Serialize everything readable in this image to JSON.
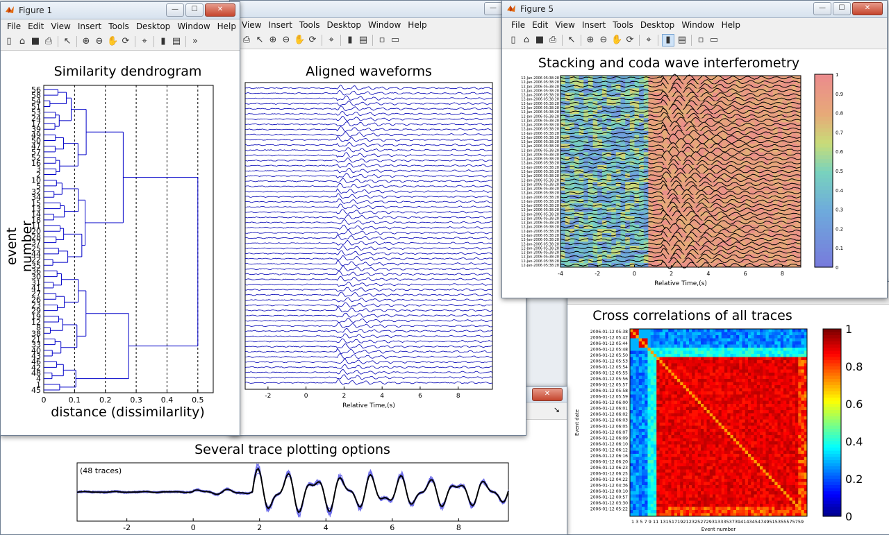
{
  "menu": [
    "File",
    "Edit",
    "View",
    "Insert",
    "Tools",
    "Desktop",
    "Window",
    "Help"
  ],
  "menu_partial": [
    "View",
    "Insert",
    "Tools",
    "Desktop",
    "Window",
    "Help"
  ],
  "fig1": {
    "title": "Figure 1",
    "plot_title": "Similarity dendrogram",
    "ylabel": "event number",
    "xlabel": "distance (dissimilarlity)",
    "xticks": [
      "0",
      "0.1",
      "0.2",
      "0.3",
      "0.4",
      "0.5"
    ],
    "leaf_labels": [
      "56",
      "58",
      "54",
      "51",
      "53",
      "24",
      "17",
      "39",
      "49",
      "50",
      "47",
      "57",
      "52",
      "16",
      "3",
      "2",
      "10",
      "5",
      "32",
      "34",
      "15",
      "13",
      "14",
      "18",
      "11",
      "20",
      "28",
      "37",
      "25",
      "44",
      "22",
      "35",
      "36",
      "30",
      "31",
      "41",
      "27",
      "26",
      "23",
      "29",
      "19",
      "12",
      "8",
      "38",
      "21",
      "33",
      "40",
      "43",
      "46",
      "42",
      "48",
      "4",
      "1",
      "45"
    ]
  },
  "fig2": {
    "plot_title": "Aligned waveforms",
    "xlabel": "Relative Time,(s)",
    "xticks": [
      "-2",
      "0",
      "2",
      "4",
      "6",
      "8"
    ]
  },
  "fig5": {
    "title": "Figure 5",
    "plot_title": "Stacking and coda wave interferometry",
    "xlabel": "Relative Time,(s)",
    "xticks": [
      "-4",
      "-2",
      "0",
      "2",
      "4",
      "6",
      "8"
    ],
    "cbar_ticks": [
      "0",
      "0.1",
      "0.2",
      "0.3",
      "0.4",
      "0.5",
      "0.6",
      "0.7",
      "0.8",
      "0.9",
      "1"
    ],
    "row_label": "12-Jan-2006 05:38:28"
  },
  "xcorr": {
    "plot_title": "Cross correlations of all traces",
    "ylabel": "Event date",
    "xlabel": "Event number",
    "ytick_labels": [
      "2006-01-12 05:38",
      "2006-01-12 05:42",
      "2006-01-12 05:44",
      "2006-01-12 05:48",
      "2006-01-12 05:50",
      "2006-01-12 05:53",
      "2006-01-12 05:54",
      "2006-01-12 05:55",
      "2006-01-12 05:56",
      "2006-01-12 05:57",
      "2006-01-12 05:58",
      "2006-01-12 05:59",
      "2006-01-12 06:00",
      "2006-01-12 06:01",
      "2006-01-12 06:02",
      "2006-01-12 06:03",
      "2006-01-12 06:05",
      "2006-01-12 06:07",
      "2006-01-12 06:09",
      "2006-01-12 06:10",
      "2006-01-12 06:12",
      "2006-01-12 06:16",
      "2006-01-12 06:20",
      "2006-01-12 06:23",
      "2006-01-12 06:25",
      "2006-01-12 04:22",
      "2006-01-12 04:36",
      "2006-01-12 00:10",
      "2006-01-12 00:57",
      "2006-01-12 03:30",
      "2006-01-12 05:22"
    ],
    "xtick_labels": "1 3 5 7 9 11 13151719212325272931333537394143454749515355575759",
    "cbar_ticks": [
      "0",
      "0.2",
      "0.4",
      "0.6",
      "0.8",
      "1"
    ]
  },
  "stack": {
    "plot_title": "Several trace plotting options",
    "annotation": "(48 traces)",
    "xticks": [
      "-2",
      "0",
      "2",
      "4",
      "6",
      "8"
    ]
  }
}
